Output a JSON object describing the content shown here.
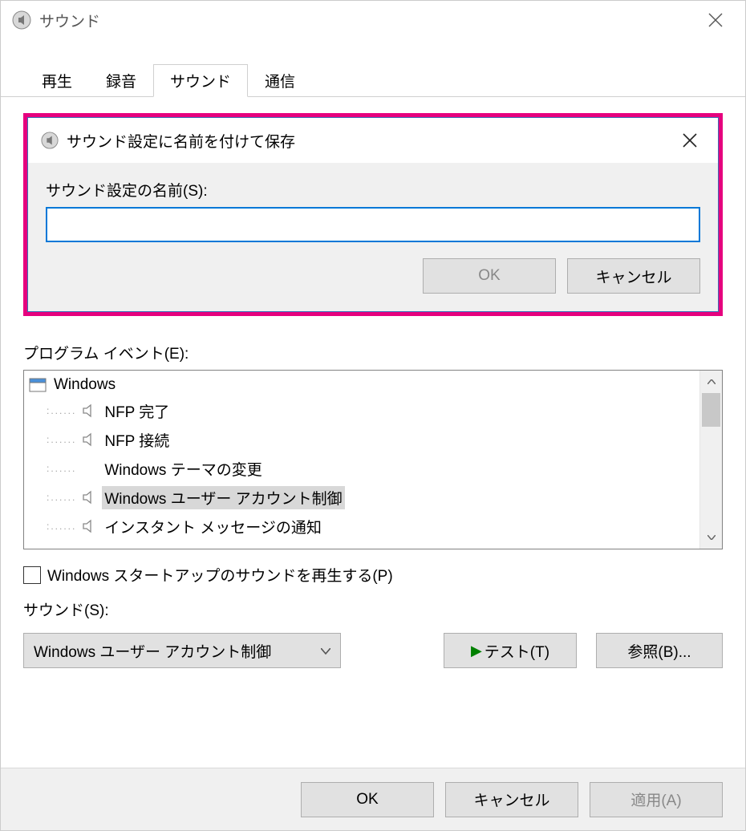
{
  "window": {
    "title": "サウンド"
  },
  "tabs": {
    "items": [
      "再生",
      "録音",
      "サウンド",
      "通信"
    ],
    "active_index": 2
  },
  "save_dialog": {
    "title": "サウンド設定に名前を付けて保存",
    "label": "サウンド設定の名前(S):",
    "value": "",
    "ok": "OK",
    "cancel": "キャンセル"
  },
  "events": {
    "label": "プログラム イベント(E):",
    "root": "Windows",
    "items": [
      {
        "label": "NFP 完了",
        "has_sound": true,
        "selected": false
      },
      {
        "label": "NFP 接続",
        "has_sound": true,
        "selected": false
      },
      {
        "label": "Windows テーマの変更",
        "has_sound": false,
        "selected": false
      },
      {
        "label": "Windows ユーザー アカウント制御",
        "has_sound": true,
        "selected": true
      },
      {
        "label": "インスタント メッセージの通知",
        "has_sound": true,
        "selected": false
      }
    ]
  },
  "startup_checkbox": {
    "label": "Windows スタートアップのサウンドを再生する(P)",
    "checked": false
  },
  "sound_combo": {
    "label": "サウンド(S):",
    "selected": "Windows ユーザー アカウント制御"
  },
  "buttons": {
    "test": "テスト(T)",
    "browse": "参照(B)...",
    "ok": "OK",
    "cancel": "キャンセル",
    "apply": "適用(A)"
  }
}
